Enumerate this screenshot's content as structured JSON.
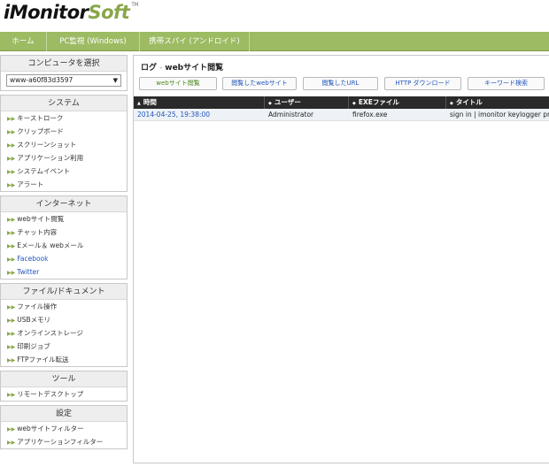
{
  "logo": {
    "main": "iMonitor",
    "accent": "Soft",
    "tm": "TM"
  },
  "nav": [
    {
      "label": "ホーム"
    },
    {
      "label": "PC監視 (Windows)"
    },
    {
      "label": "携帯スパイ (アンドロイド)"
    }
  ],
  "sidebar": {
    "computer": {
      "title": "コンピュータを選択",
      "selected": "www-a60f83d3597"
    },
    "system": {
      "title": "システム",
      "items": [
        "キーストローク",
        "クリップボード",
        "スクリーンショット",
        "アプリケーション利用",
        "システムイベント",
        "アラート"
      ]
    },
    "internet": {
      "title": "インターネット",
      "items": [
        "webサイト閲覧",
        "チャット内容",
        "Eメール＆ webメール",
        "Facebook",
        "Twitter"
      ]
    },
    "files": {
      "title": "ファイル/ドキュメント",
      "items": [
        "ファイル操作",
        "USBメモリ",
        "オンラインストレージ",
        "印刷ジョブ",
        "FTPファイル転送"
      ]
    },
    "tools": {
      "title": "ツール",
      "items": [
        "リモートデスクトップ"
      ]
    },
    "settings": {
      "title": "設定",
      "items": [
        "webサイトフィルター",
        "アプリケーションフィルター"
      ]
    }
  },
  "main": {
    "breadcrumb": {
      "section": "ログ",
      "sep": "-",
      "page": "webサイト閲覧"
    },
    "tabs": [
      "webサイト閲覧",
      "閲覧したwebサイト",
      "閲覧したURL",
      "HTTP ダウンロード",
      "キーワード検索"
    ],
    "columns": [
      "時間",
      "ユーザー",
      "EXEファイル",
      "タイトル"
    ],
    "rows": [
      {
        "time": "2014-04-25, 19:38:00",
        "user": "Administrator",
        "exe": "firefox.exe",
        "title": "sign in | imonitor keylogger pro and"
      }
    ]
  },
  "colors": {
    "nav": "#9cbb62",
    "accent": "#8aa64a",
    "link": "#2255bb",
    "gridHead": "#2a2a2a"
  }
}
